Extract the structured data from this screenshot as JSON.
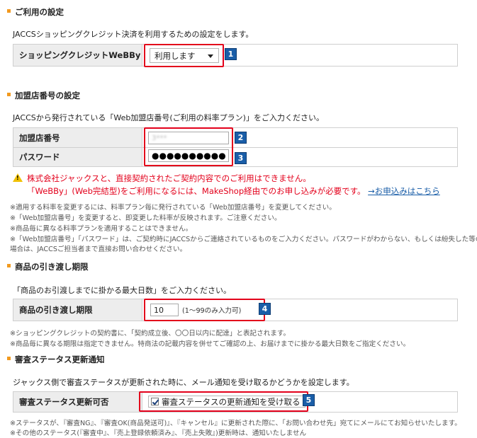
{
  "sections": {
    "usage": {
      "title": "ご利用の設定",
      "desc": "JACCSショッピングクレジット決済を利用するための設定をします。",
      "field_label": "ショッピングクレジットWeBBy",
      "select_value": "利用します",
      "badge": "1"
    },
    "merchant": {
      "title": "加盟店番号の設定",
      "desc": "JACCSから発行されている「Web加盟店番号(ご利用の料率プラン)」をご入力ください。",
      "number_label": "加盟店番号",
      "number_value": "3***",
      "number_badge": "2",
      "password_label": "パスワード",
      "password_value": "●●●●●●●●●●",
      "password_badge": "3",
      "warning_line1": "株式会社ジャックスと、直接契約されたご契約内容でのご利用はできません。",
      "warning_line2": "「WeBBy」(Web完結型)をご利用になるには、MakeShop経由でのお申し込みが必要です。",
      "warning_link": "→お申込みはこちら",
      "notes": [
        "※適用する料率を変更するには、料率プラン毎に発行されている「Web加盟店番号」を変更してください。",
        "※「Web加盟店番号」を変更すると、即変更した料率が反映されます。ご注意ください。",
        "※商品毎に異なる料率プランを適用することはできません。",
        "※「Web加盟店番号」「パスワード」は、ご契約時にJACCSからご連絡されているものをご入力ください。パスワードがわからない、もしくは紛失した等の",
        "場合は、JACCSご担当者まで直接お問い合わせください。"
      ]
    },
    "delivery": {
      "title": "商品の引き渡し期限",
      "desc": "「商品のお引渡しまでに掛かる最大日数」をご入力ください。",
      "field_label": "商品の引き渡し期限",
      "input_value": "10",
      "hint": "(1〜99のみ入力可)",
      "badge": "4",
      "notes": [
        "※ショッピングクレジットの契約書に、「契約成立後、〇〇日以内に配達」と表記されます。",
        "※商品毎に異なる期限は指定できません。特商法の記載内容を併せてご確認の上、お届けまでに掛かる最大日数をご指定ください。"
      ]
    },
    "status": {
      "title": "審査ステータス更新通知",
      "desc": "ジャックス側で審査ステータスが更新された時に、メール通知を受け取るかどうかを設定します。",
      "field_label": "審査ステータス更新可否",
      "checkbox_label": "審査ステータスの更新通知を受け取る",
      "badge": "5",
      "notes": [
        "※ステータスが、『審査NG』、『審査OK(商品発送可)』、『キャンセル』に更新された際に、「お問い合わせ先」宛てにメールにてお知らせいたします。",
        "※その他のステータス(『審査中』、『売上登録依頼済み』、『売上失敗』)更新時は、通知いたしません"
      ]
    }
  },
  "colors": {
    "accent": "#f29a1f",
    "highlight": "#e3001b",
    "badge": "#1a5ea8"
  }
}
